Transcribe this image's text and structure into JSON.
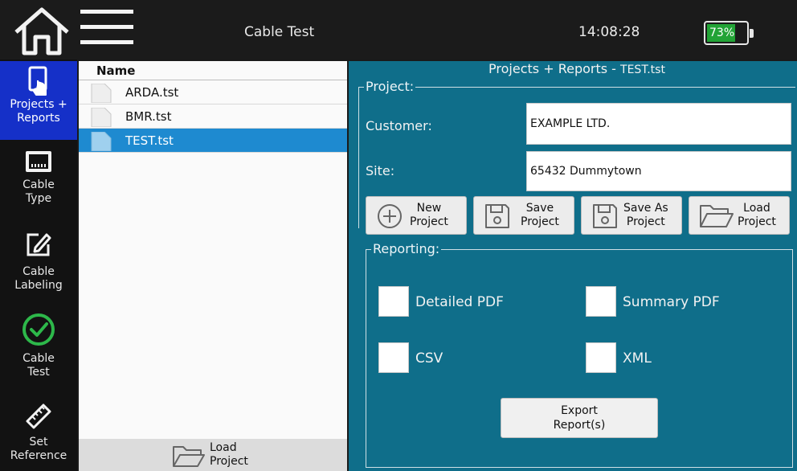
{
  "header": {
    "title": "Cable Test",
    "time": "14:08:28",
    "battery_percent": "73%",
    "battery_level": 0.73,
    "battery_color": "#22a336"
  },
  "sidebar": {
    "items": [
      {
        "icon": "tap-document-icon",
        "label_1": "Projects +",
        "label_2": "Reports",
        "active": true
      },
      {
        "icon": "ethernet-port-icon",
        "label_1": "Cable",
        "label_2": "Type"
      },
      {
        "icon": "edit-icon",
        "label_1": "Cable",
        "label_2": "Labeling"
      },
      {
        "icon": "check-circle-icon",
        "label_1": "Cable",
        "label_2": "Test"
      },
      {
        "icon": "ruler-icon",
        "label_1": "Set",
        "label_2": "Reference"
      }
    ],
    "active_color": "#1530c8"
  },
  "file_list": {
    "column_header": "Name",
    "files": [
      "ARDA.tst",
      "BMR.tst",
      "TEST.tst"
    ],
    "selected": "TEST.tst",
    "load_button_1": "Load",
    "load_button_2": "Project"
  },
  "panel": {
    "title": "Projects + Reports - ",
    "title_file": "TEST.tst",
    "project_group": "Project:",
    "customer_label": "Customer:",
    "customer_value": "EXAMPLE LTD.",
    "site_label": "Site:",
    "site_value": "65432 Dummytown",
    "buttons": [
      {
        "line1": "New",
        "line2": "Project",
        "icon": "plus-circle-icon"
      },
      {
        "line1": "Save",
        "line2": "Project",
        "icon": "save-icon"
      },
      {
        "line1": "Save As",
        "line2": "Project",
        "icon": "save-icon"
      },
      {
        "line1": "Load",
        "line2": "Project",
        "icon": "folder-icon"
      }
    ],
    "reporting_group": "Reporting:",
    "options": {
      "detailed_pdf": "Detailed PDF",
      "summary_pdf": "Summary PDF",
      "csv": "CSV",
      "xml": "XML"
    },
    "export_line1": "Export",
    "export_line2": "Report(s)",
    "background_color": "#0f6e8a"
  }
}
